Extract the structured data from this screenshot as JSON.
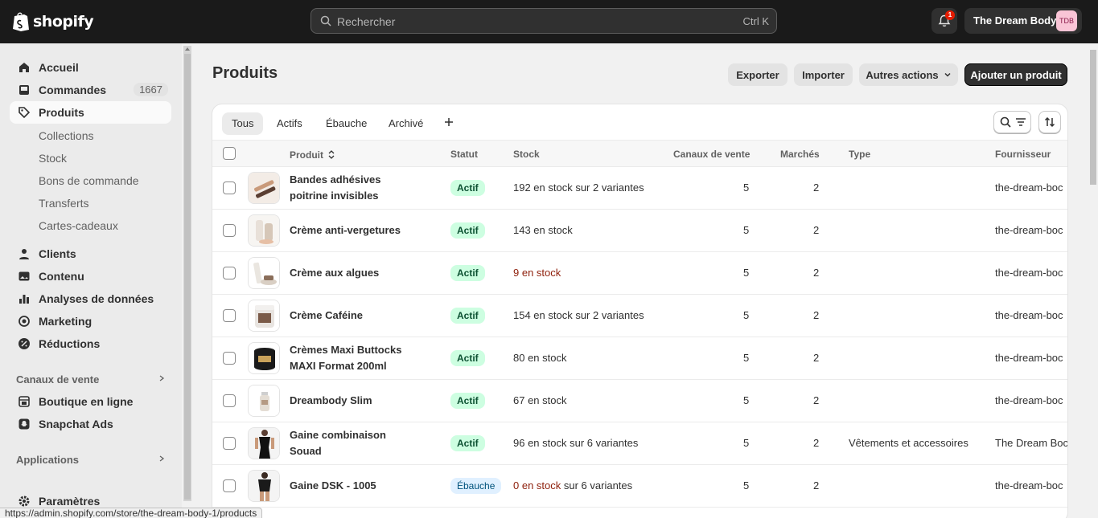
{
  "topbar": {
    "brand": "shopify",
    "search_placeholder": "Rechercher",
    "search_shortcut": "Ctrl K",
    "notification_count": "1",
    "store_name": "The Dream Body",
    "store_initials": "TDB"
  },
  "sidebar": {
    "items": [
      {
        "label": "Accueil",
        "icon": "home-icon"
      },
      {
        "label": "Commandes",
        "icon": "inbox-icon",
        "count": "1667"
      },
      {
        "label": "Produits",
        "icon": "tag-icon"
      },
      {
        "label": "Clients",
        "icon": "person-icon"
      },
      {
        "label": "Contenu",
        "icon": "image-icon"
      },
      {
        "label": "Analyses de données",
        "icon": "chart-icon"
      },
      {
        "label": "Marketing",
        "icon": "target-icon"
      },
      {
        "label": "Réductions",
        "icon": "discount-icon"
      }
    ],
    "product_subitems": [
      "Collections",
      "Stock",
      "Bons de commande",
      "Transferts",
      "Cartes-cadeaux"
    ],
    "sales_channels_title": "Canaux de vente",
    "sales_channels": [
      {
        "label": "Boutique en ligne",
        "icon": "store-icon"
      },
      {
        "label": "Snapchat Ads",
        "icon": "snapchat-icon"
      }
    ],
    "apps_title": "Applications",
    "settings_label": "Paramètres"
  },
  "header": {
    "title": "Produits",
    "export_label": "Exporter",
    "import_label": "Importer",
    "more_actions_label": "Autres actions",
    "add_product_label": "Ajouter un produit"
  },
  "tabs": [
    "Tous",
    "Actifs",
    "Ébauche",
    "Archivé"
  ],
  "table": {
    "columns": {
      "product": "Produit",
      "status": "Statut",
      "stock": "Stock",
      "channels": "Canaux de vente",
      "markets": "Marchés",
      "type": "Type",
      "vendor": "Fournisseur"
    },
    "rows": [
      {
        "name_line1": "Bandes adhésives",
        "name_line2": "poitrine invisibles",
        "status": "Actif",
        "stock_main": "192 en stock",
        "stock_suffix": " sur 2 variantes",
        "low": false,
        "channels": "5",
        "markets": "2",
        "type": "",
        "vendor": "the-dream-boc"
      },
      {
        "name_line1": "Crème anti-vergetures",
        "name_line2": "",
        "status": "Actif",
        "stock_main": "143 en stock",
        "stock_suffix": "",
        "low": false,
        "channels": "5",
        "markets": "2",
        "type": "",
        "vendor": "the-dream-boc"
      },
      {
        "name_line1": "Crème aux algues",
        "name_line2": "",
        "status": "Actif",
        "stock_main": "9 en stock",
        "stock_suffix": "",
        "low": true,
        "channels": "5",
        "markets": "2",
        "type": "",
        "vendor": "the-dream-boc"
      },
      {
        "name_line1": "Crème Caféine",
        "name_line2": "",
        "status": "Actif",
        "stock_main": "154 en stock",
        "stock_suffix": " sur 2 variantes",
        "low": false,
        "channels": "5",
        "markets": "2",
        "type": "",
        "vendor": "the-dream-boc"
      },
      {
        "name_line1": "Crèmes Maxi Buttocks",
        "name_line2": "MAXI Format 200ml",
        "status": "Actif",
        "stock_main": "80 en stock",
        "stock_suffix": "",
        "low": false,
        "channels": "5",
        "markets": "2",
        "type": "",
        "vendor": "the-dream-boc"
      },
      {
        "name_line1": "Dreambody Slim",
        "name_line2": "",
        "status": "Actif",
        "stock_main": "67 en stock",
        "stock_suffix": "",
        "low": false,
        "channels": "5",
        "markets": "2",
        "type": "",
        "vendor": "the-dream-boc"
      },
      {
        "name_line1": "Gaine combinaison",
        "name_line2": "Souad",
        "status": "Actif",
        "stock_main": "96 en stock",
        "stock_suffix": " sur 6 variantes",
        "low": false,
        "channels": "5",
        "markets": "2",
        "type": "Vêtements et accessoires",
        "vendor": "The Dream Boc"
      },
      {
        "name_line1": "Gaine DSK - 1005",
        "name_line2": "",
        "status": "Ébauche",
        "stock_main": "0 en stock",
        "stock_suffix": " sur 6 variantes",
        "low": true,
        "channels": "5",
        "markets": "2",
        "type": "",
        "vendor": "the-dream-boc"
      }
    ]
  },
  "status_url": "https://admin.shopify.com/store/the-dream-body-1/products",
  "colors": {
    "topbar": "#1a1a1a",
    "active_badge": "#cdfee1",
    "draft_badge": "#e0f0ff",
    "low_stock": "#8e1f0b"
  }
}
